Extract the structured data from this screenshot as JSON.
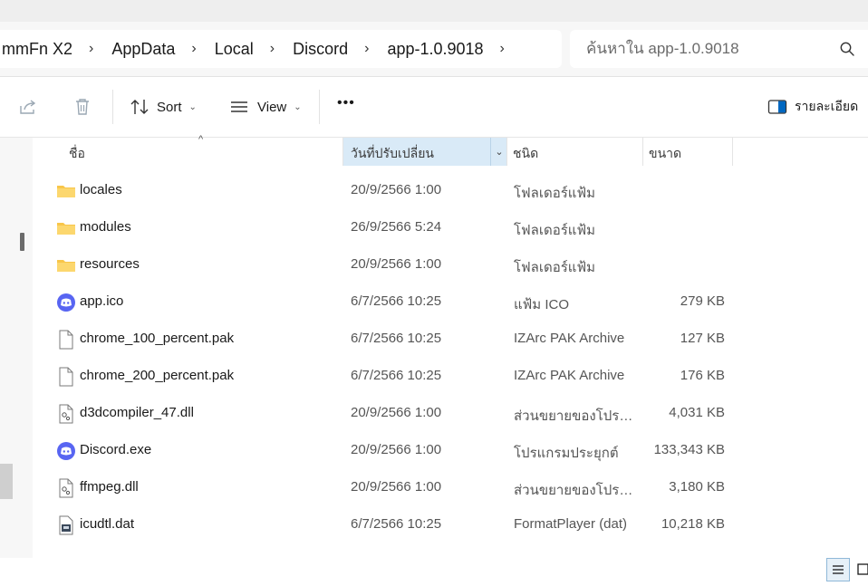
{
  "address": {
    "breadcrumbs": [
      "mmFn X2",
      "AppData",
      "Local",
      "Discord",
      "app-1.0.9018"
    ],
    "separator": "›"
  },
  "search": {
    "placeholder": "ค้นหาใน app-1.0.9018",
    "icon": "search-icon"
  },
  "toolbar": {
    "share_icon": "share-icon",
    "delete_icon": "trash-icon",
    "sort_label": "Sort",
    "view_label": "View",
    "more_label": "•••",
    "details_label": "รายละเอียด"
  },
  "columns": {
    "name": "ชื่อ",
    "date": "วันที่ปรับเปลี่ยน",
    "type": "ชนิด",
    "size": "ขนาด"
  },
  "files": [
    {
      "name": "locales",
      "date": "20/9/2566 1:00",
      "type": "โฟลเดอร์แฟ้ม",
      "size": "",
      "icon": "folder"
    },
    {
      "name": "modules",
      "date": "26/9/2566 5:24",
      "type": "โฟลเดอร์แฟ้ม",
      "size": "",
      "icon": "folder"
    },
    {
      "name": "resources",
      "date": "20/9/2566 1:00",
      "type": "โฟลเดอร์แฟ้ม",
      "size": "",
      "icon": "folder"
    },
    {
      "name": "app.ico",
      "date": "6/7/2566 10:25",
      "type": "แฟ้ม ICO",
      "size": "279 KB",
      "icon": "discord"
    },
    {
      "name": "chrome_100_percent.pak",
      "date": "6/7/2566 10:25",
      "type": "IZArc PAK Archive",
      "size": "127 KB",
      "icon": "file"
    },
    {
      "name": "chrome_200_percent.pak",
      "date": "6/7/2566 10:25",
      "type": "IZArc PAK Archive",
      "size": "176 KB",
      "icon": "file"
    },
    {
      "name": "d3dcompiler_47.dll",
      "date": "20/9/2566 1:00",
      "type": "ส่วนขยายของโปรแกร...",
      "size": "4,031 KB",
      "icon": "dll"
    },
    {
      "name": "Discord.exe",
      "date": "20/9/2566 1:00",
      "type": "โปรแกรมประยุกต์",
      "size": "133,343 KB",
      "icon": "discord"
    },
    {
      "name": "ffmpeg.dll",
      "date": "20/9/2566 1:00",
      "type": "ส่วนขยายของโปรแกร...",
      "size": "3,180 KB",
      "icon": "dll"
    },
    {
      "name": "icudtl.dat",
      "date": "6/7/2566 10:25",
      "type": "FormatPlayer (dat)",
      "size": "10,218 KB",
      "icon": "dat"
    }
  ],
  "colors": {
    "accent": "#0067c0",
    "discord": "#5865f2",
    "folder": "#f8c64a",
    "selectedColumn": "#d9eaf7"
  }
}
